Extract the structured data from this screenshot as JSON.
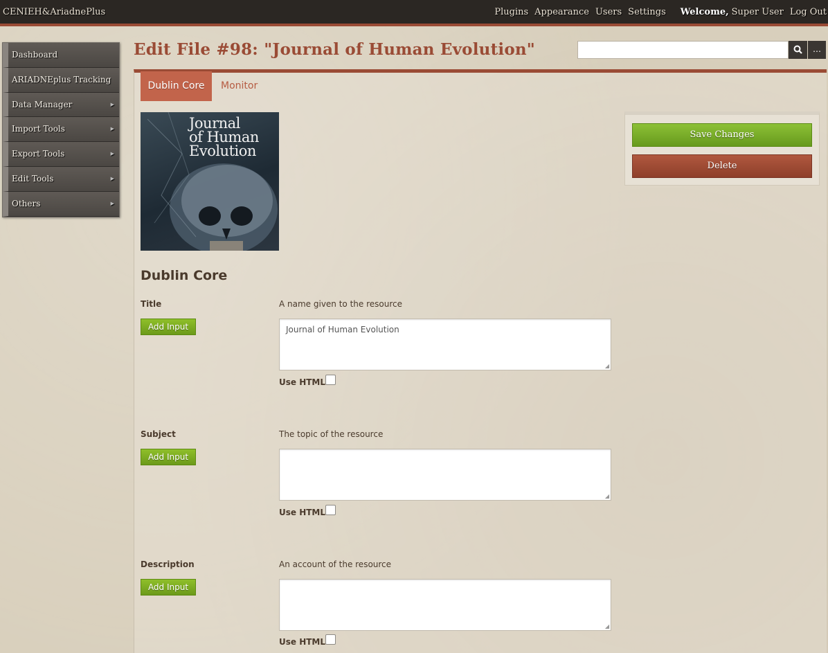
{
  "header": {
    "site_title": "CENIEH&AriadnePlus",
    "nav": [
      "Plugins",
      "Appearance",
      "Users",
      "Settings"
    ],
    "welcome": "Welcome,",
    "user_name": "Super User",
    "logout": "Log Out"
  },
  "sidebar": {
    "items": [
      {
        "label": "Dashboard",
        "has_submenu": false
      },
      {
        "label": "ARIADNEplus Tracking",
        "has_submenu": false
      },
      {
        "label": "Data Manager",
        "has_submenu": true
      },
      {
        "label": "Import Tools",
        "has_submenu": true
      },
      {
        "label": "Export Tools",
        "has_submenu": true
      },
      {
        "label": "Edit Tools",
        "has_submenu": true
      },
      {
        "label": "Others",
        "has_submenu": true
      }
    ]
  },
  "page": {
    "title": "Edit File #98: \"Journal of Human Evolution\"",
    "search_value": "",
    "search_icon": "search-icon",
    "advanced_search_label": "…"
  },
  "tabs": {
    "active": "Dublin Core",
    "inactive": "Monitor"
  },
  "cover": {
    "text_lines": [
      "Journal",
      "of Human",
      "Evolution"
    ]
  },
  "section_title": "Dublin Core",
  "elements": [
    {
      "label": "Title",
      "description": "A name given to the resource",
      "add_input_label": "Add Input",
      "value": "Journal of Human Evolution",
      "use_html_label": "Use HTML",
      "use_html_checked": false
    },
    {
      "label": "Subject",
      "description": "The topic of the resource",
      "add_input_label": "Add Input",
      "value": "",
      "use_html_label": "Use HTML",
      "use_html_checked": false
    },
    {
      "label": "Description",
      "description": "An account of the resource",
      "add_input_label": "Add Input",
      "value": "",
      "use_html_label": "Use HTML",
      "use_html_checked": false
    }
  ],
  "actions": {
    "save_label": "Save Changes",
    "delete_label": "Delete"
  },
  "colors": {
    "accent": "#9a4b35",
    "save_green": "#7aab25",
    "delete_red": "#9e4a33",
    "topbar": "#2b2723"
  }
}
